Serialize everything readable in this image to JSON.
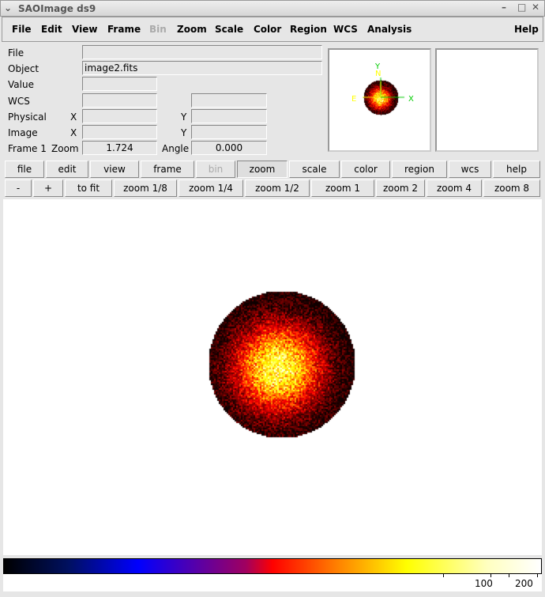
{
  "window": {
    "title": "SAOImage ds9"
  },
  "menu": [
    "File",
    "Edit",
    "View",
    "Frame",
    "Bin",
    "Zoom",
    "Scale",
    "Color",
    "Region",
    "WCS",
    "Analysis",
    "Help"
  ],
  "info": {
    "file_label": "File",
    "file_value": "",
    "object_label": "Object",
    "object_value": "image2.fits",
    "value_label": "Value",
    "wcs_label": "WCS",
    "physical_label": "Physical",
    "image_label": "Image",
    "x": "X",
    "y": "Y",
    "frame_label": "Frame 1",
    "zoom_label": "Zoom",
    "zoom_value": "1.724",
    "angle_label": "Angle",
    "angle_value": "0.000"
  },
  "panner": {
    "north": "N",
    "east": "E",
    "x_axis": "X",
    "y_axis": "Y"
  },
  "buttons_main": [
    "file",
    "edit",
    "view",
    "frame",
    "bin",
    "zoom",
    "scale",
    "color",
    "region",
    "wcs",
    "help"
  ],
  "buttons_main_selected": "zoom",
  "buttons_zoom": [
    "-",
    "+",
    "to fit",
    "zoom 1/8",
    "zoom 1/4",
    "zoom 1/2",
    "zoom 1",
    "zoom 2",
    "zoom 4",
    "zoom 8"
  ],
  "colorbar": {
    "colormap": "heat-like (black-blue-red-yellow-white)",
    "ticks": [
      "100",
      "200"
    ]
  }
}
